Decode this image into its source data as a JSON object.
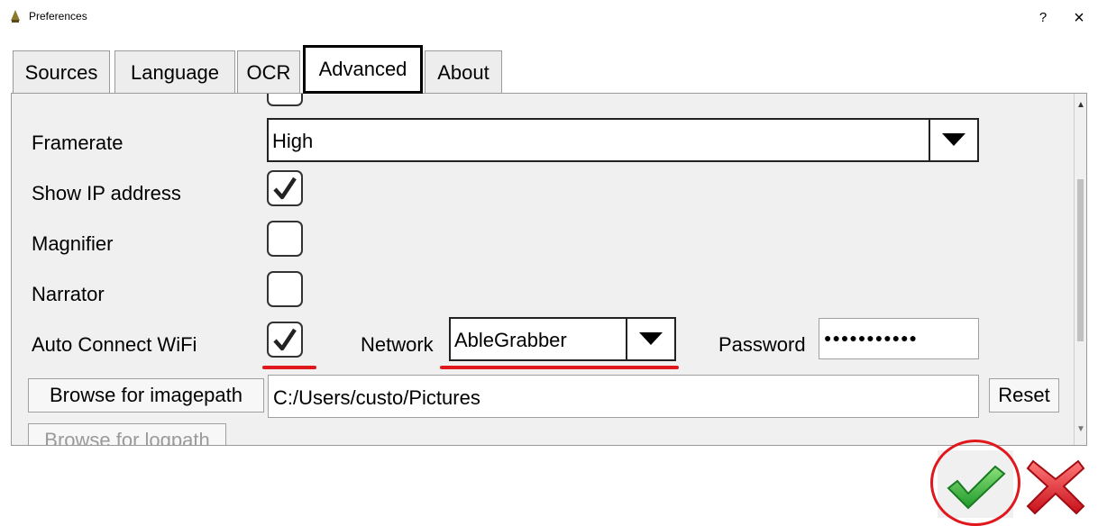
{
  "window": {
    "title": "Preferences",
    "help_label": "?",
    "close_label": "×"
  },
  "tabs": [
    {
      "label": "Sources",
      "active": false
    },
    {
      "label": "Language",
      "active": false
    },
    {
      "label": "OCR",
      "active": false
    },
    {
      "label": "Advanced",
      "active": true
    },
    {
      "label": "About",
      "active": false
    }
  ],
  "settings": {
    "framerate": {
      "label": "Framerate",
      "value": "High"
    },
    "show_ip": {
      "label": "Show IP address",
      "checked": true
    },
    "magnifier": {
      "label": "Magnifier",
      "checked": false
    },
    "narrator": {
      "label": "Narrator",
      "checked": false
    },
    "auto_connect": {
      "label": "Auto Connect WiFi",
      "checked": true
    },
    "network": {
      "label": "Network",
      "value": "AbleGrabber"
    },
    "password": {
      "label": "Password",
      "value": "●●●●●●●●●●●"
    },
    "imagepath": {
      "button_label": "Browse for imagepath",
      "value": "C:/Users/custo/Pictures",
      "reset_label": "Reset"
    },
    "logpath": {
      "button_label": "Browse for logpath"
    }
  },
  "colors": {
    "annotation_red": "#e0181d",
    "ok_green": "#3fbf3f",
    "cancel_red": "#e8232a"
  },
  "icons": {
    "ok": "green-checkmark-icon",
    "cancel": "red-x-icon",
    "app": "app-icon"
  }
}
